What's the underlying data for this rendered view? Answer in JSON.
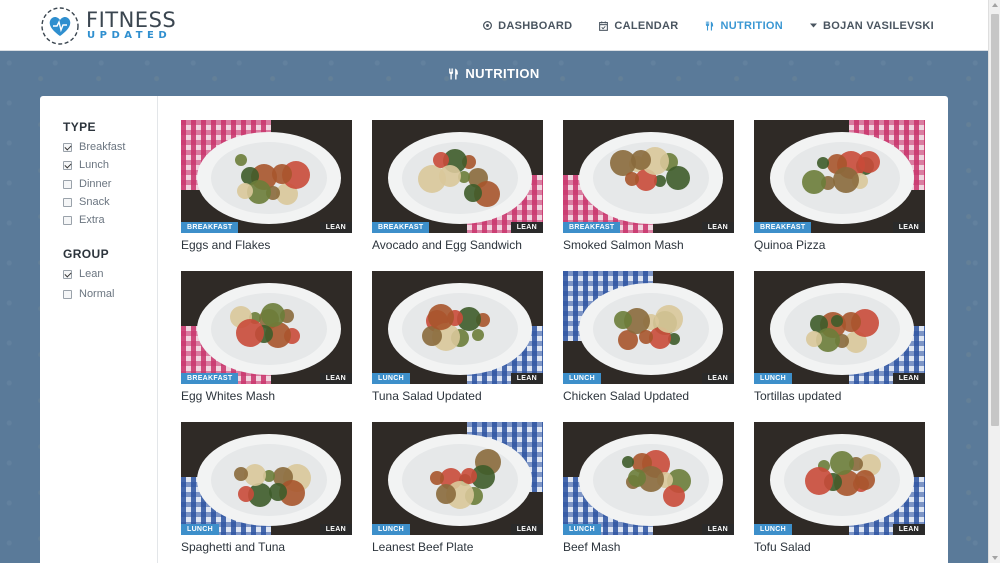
{
  "header": {
    "logo_title": "FITNESS",
    "logo_subtitle": "UPDATED",
    "nav": [
      {
        "label": "DASHBOARD",
        "icon": "dashboard-icon",
        "active": false
      },
      {
        "label": "CALENDAR",
        "icon": "calendar-icon",
        "active": false
      },
      {
        "label": "NUTRITION",
        "icon": "fork-knife-icon",
        "active": true
      },
      {
        "label": "BOJAN VASILEVSKI",
        "icon": "caret-down-icon",
        "active": false
      }
    ]
  },
  "page": {
    "title": "NUTRITION",
    "title_icon": "fork-knife-icon"
  },
  "filters": {
    "type": {
      "title": "TYPE",
      "options": [
        {
          "label": "Breakfast",
          "checked": true
        },
        {
          "label": "Lunch",
          "checked": true
        },
        {
          "label": "Dinner",
          "checked": false
        },
        {
          "label": "Snack",
          "checked": false
        },
        {
          "label": "Extra",
          "checked": false
        }
      ]
    },
    "group": {
      "title": "GROUP",
      "options": [
        {
          "label": "Lean",
          "checked": true
        },
        {
          "label": "Normal",
          "checked": false
        }
      ]
    }
  },
  "meals": [
    {
      "name": "Eggs and Flakes",
      "type": "BREAKFAST",
      "group": "LEAN",
      "cloth": "pink"
    },
    {
      "name": "Avocado and Egg Sandwich",
      "type": "BREAKFAST",
      "group": "LEAN",
      "cloth": "pink"
    },
    {
      "name": "Smoked Salmon Mash",
      "type": "BREAKFAST",
      "group": "LEAN",
      "cloth": "pink"
    },
    {
      "name": "Quinoa Pizza",
      "type": "BREAKFAST",
      "group": "LEAN",
      "cloth": "pink"
    },
    {
      "name": "Egg Whites Mash",
      "type": "BREAKFAST",
      "group": "LEAN",
      "cloth": "pink"
    },
    {
      "name": "Tuna Salad Updated",
      "type": "LUNCH",
      "group": "LEAN",
      "cloth": "blue"
    },
    {
      "name": "Chicken Salad Updated",
      "type": "LUNCH",
      "group": "LEAN",
      "cloth": "blue"
    },
    {
      "name": "Tortillas updated",
      "type": "LUNCH",
      "group": "LEAN",
      "cloth": "blue"
    },
    {
      "name": "Spaghetti and Tuna",
      "type": "LUNCH",
      "group": "LEAN",
      "cloth": "blue"
    },
    {
      "name": "Leanest Beef Plate",
      "type": "LUNCH",
      "group": "LEAN",
      "cloth": "blue"
    },
    {
      "name": "Beef Mash",
      "type": "LUNCH",
      "group": "LEAN",
      "cloth": "blue"
    },
    {
      "name": "Tofu Salad",
      "type": "LUNCH",
      "group": "LEAN",
      "cloth": "blue"
    }
  ],
  "colors": {
    "accent": "#3a97d3",
    "banner": "#5a7a99",
    "badge_type": "#3d8fca",
    "badge_group": "#2a2a2a"
  }
}
